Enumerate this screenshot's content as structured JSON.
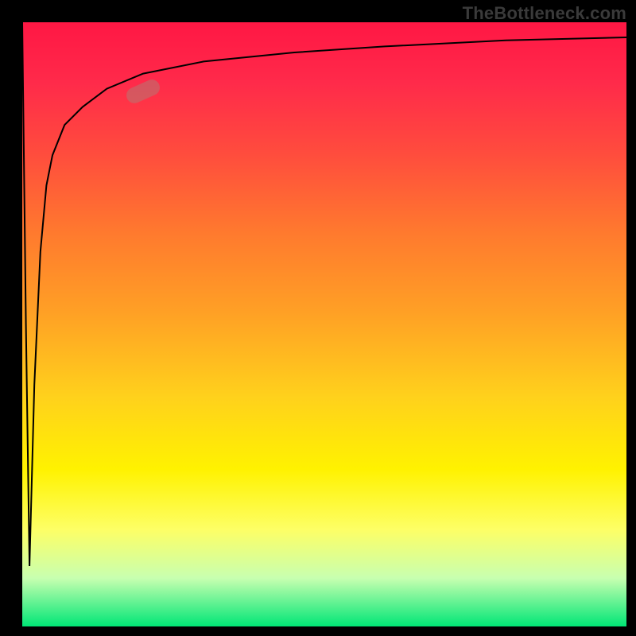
{
  "watermark": "TheBottleneck.com",
  "chart_data": {
    "type": "line",
    "title": "",
    "xlabel": "",
    "ylabel": "",
    "xlim": [
      0,
      100
    ],
    "ylim": [
      0,
      100
    ],
    "grid": false,
    "legend": false,
    "gradient_background": {
      "direction": "vertical",
      "stops": [
        {
          "pos": 0.0,
          "color": "#ff1744"
        },
        {
          "pos": 0.5,
          "color": "#ffb300"
        },
        {
          "pos": 0.8,
          "color": "#ffff33"
        },
        {
          "pos": 1.0,
          "color": "#00e676"
        }
      ]
    },
    "series": [
      {
        "name": "bottleneck-curve",
        "x": [
          0,
          0.6,
          1.2,
          2.0,
          3.0,
          4.0,
          5.0,
          7.0,
          10.0,
          14.0,
          20.0,
          30.0,
          45.0,
          60.0,
          80.0,
          100.0
        ],
        "y": [
          100,
          50,
          10,
          40,
          62,
          73,
          78,
          83,
          86,
          89,
          91.5,
          93.5,
          95,
          96,
          97,
          97.5
        ]
      }
    ],
    "marker": {
      "series": "bottleneck-curve",
      "x": 20.0,
      "y": 88.5,
      "shape": "pill",
      "color": "rgba(180,120,115,0.55)",
      "angle_deg": -24
    }
  }
}
